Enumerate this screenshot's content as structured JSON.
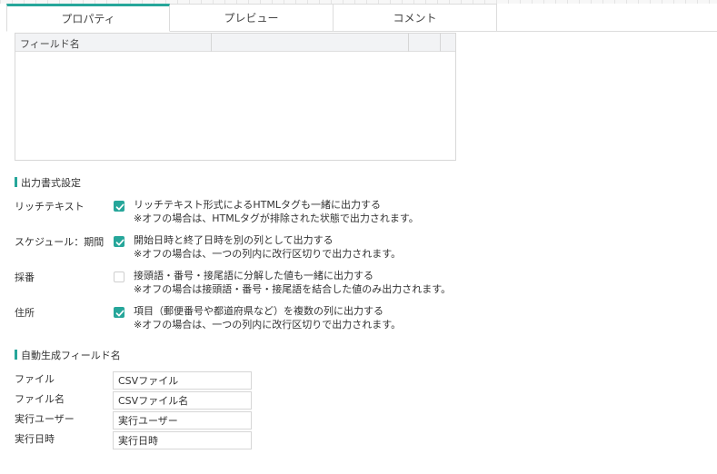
{
  "tabs": [
    {
      "label": "プロパティ",
      "active": true
    },
    {
      "label": "プレビュー",
      "active": false
    },
    {
      "label": "コメント",
      "active": false
    }
  ],
  "field_table": {
    "column_header": "フィールド名"
  },
  "output_format": {
    "title": "出力書式設定",
    "options": [
      {
        "label": "リッチテキスト",
        "checked": true,
        "text": "リッチテキスト形式によるHTMLタグも一緒に出力する",
        "note": "※オフの場合は、HTMLタグが排除された状態で出力されます。"
      },
      {
        "label": "スケジュール：期間",
        "checked": true,
        "text": "開始日時と終了日時を別の列として出力する",
        "note": "※オフの場合は、一つの列内に改行区切りで出力されます。"
      },
      {
        "label": "採番",
        "checked": false,
        "text": "接頭語・番号・接尾語に分解した値も一緒に出力する",
        "note": "※オフの場合は接頭語・番号・接尾語を結合した値のみ出力されます。"
      },
      {
        "label": "住所",
        "checked": true,
        "text": "項目（郵便番号や都道府県など）を複数の列に出力する",
        "note": "※オフの場合は、一つの列内に改行区切りで出力されます。"
      }
    ]
  },
  "auto_fields": {
    "title": "自動生成フィールド名",
    "rows": [
      {
        "label": "ファイル",
        "value": "CSVファイル"
      },
      {
        "label": "ファイル名",
        "value": "CSVファイル名"
      },
      {
        "label": "実行ユーザー",
        "value": "実行ユーザー"
      },
      {
        "label": "実行日時",
        "value": "実行日時"
      }
    ]
  },
  "colors": {
    "accent": "#26a69a"
  }
}
